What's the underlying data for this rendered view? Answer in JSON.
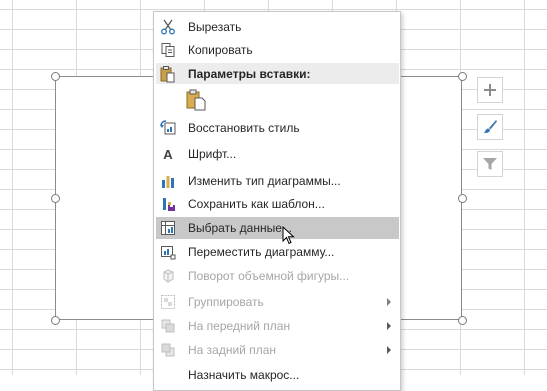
{
  "context_menu": {
    "cut": {
      "label": "Вырезать",
      "icon": "scissors-icon"
    },
    "copy": {
      "label": "Копировать",
      "icon": "copy-icon"
    },
    "paste_options": {
      "label": "Параметры вставки:",
      "icon": "clipboard-icon"
    },
    "reset_style": {
      "label": "Восстановить стиль",
      "icon": "reset-style-icon"
    },
    "font": {
      "label": "Шрифт...",
      "icon": "font-icon"
    },
    "change_chart_type": {
      "label": "Изменить тип диаграммы...",
      "icon": "bar-chart-icon"
    },
    "save_as_template": {
      "label": "Сохранить как шаблон...",
      "icon": "save-template-icon"
    },
    "select_data": {
      "label": "Выбрать данные...",
      "icon": "select-data-icon"
    },
    "move_chart": {
      "label": "Переместить диаграмму...",
      "icon": "move-chart-icon"
    },
    "rotate_3d": {
      "label": "Поворот объемной фигуры...",
      "icon": "rotate-3d-icon"
    },
    "group": {
      "label": "Группировать",
      "icon": "group-icon"
    },
    "bring_forward": {
      "label": "На передний план",
      "icon": "bring-forward-icon"
    },
    "send_backward": {
      "label": "На задний план",
      "icon": "send-backward-icon"
    },
    "assign_macro": {
      "label": "Назначить макрос..."
    }
  },
  "chart_buttons": [
    "chart-elements-plus-icon",
    "chart-styles-brush-icon",
    "chart-filter-icon"
  ],
  "colors": {
    "accent_blue": "#2e75b6",
    "highlight": "#c8c8c8",
    "disabled_text": "#a6a6a6"
  }
}
